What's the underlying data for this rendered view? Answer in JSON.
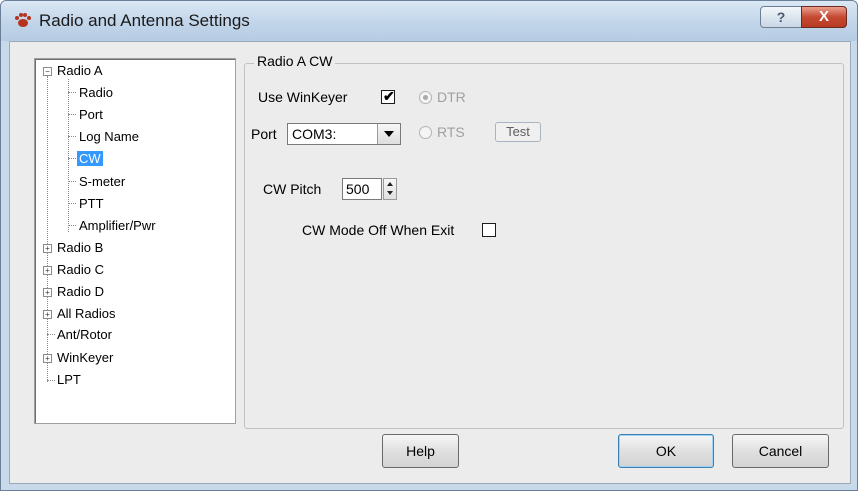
{
  "window": {
    "title": "Radio and Antenna Settings",
    "help_glyph": "?",
    "close_glyph": "X"
  },
  "tree": {
    "items": [
      {
        "label": "Radio A",
        "expanded": true
      },
      {
        "label": "Radio"
      },
      {
        "label": "Port"
      },
      {
        "label": "Log Name"
      },
      {
        "label": "CW",
        "selected": true
      },
      {
        "label": "S-meter"
      },
      {
        "label": "PTT"
      },
      {
        "label": "Amplifier/Pwr"
      },
      {
        "label": "Radio B",
        "expanded": false
      },
      {
        "label": "Radio C",
        "expanded": false
      },
      {
        "label": "Radio D",
        "expanded": false
      },
      {
        "label": "All Radios",
        "expanded": false
      },
      {
        "label": "Ant/Rotor"
      },
      {
        "label": "WinKeyer",
        "expanded": false
      },
      {
        "label": "LPT"
      }
    ],
    "expanded_glyph": "−",
    "collapsed_glyph": "+"
  },
  "group": {
    "title": "Radio A CW",
    "use_winkeyer_label": "Use WinKeyer",
    "use_winkeyer_checked": true,
    "dtr_label": "DTR",
    "rts_label": "RTS",
    "port_label": "Port",
    "port_value": "COM3:",
    "test_label": "Test",
    "cw_pitch_label": "CW Pitch",
    "cw_pitch_value": "500",
    "cw_mode_off_label": "CW Mode Off When Exit",
    "cw_mode_off_checked": false
  },
  "buttons": {
    "help": "Help",
    "ok": "OK",
    "cancel": "Cancel"
  },
  "icons": {
    "title_icon": "paw-icon",
    "checkmark": "✔"
  }
}
